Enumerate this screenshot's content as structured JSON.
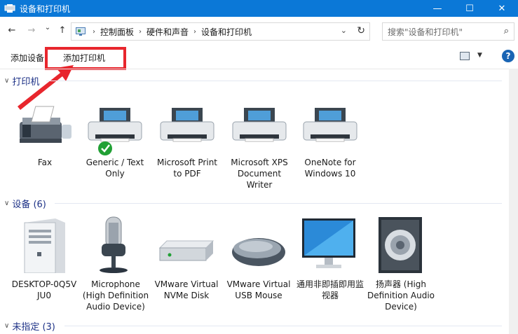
{
  "window": {
    "title": "设备和打印机",
    "min_label": "—",
    "max_label": "☐",
    "close_label": "✕"
  },
  "nav": {
    "back": "←",
    "forward": "→",
    "recent": "⌄",
    "up": "↑"
  },
  "address": {
    "crumbs": [
      "控制面板",
      "硬件和声音",
      "设备和打印机"
    ],
    "dropdown": "⌄",
    "refresh": "↻"
  },
  "search": {
    "placeholder": "搜索\"设备和打印机\"",
    "icon": "⌕"
  },
  "toolbar": {
    "add_device": "添加设备",
    "add_printer": "添加打印机",
    "help": "?"
  },
  "groups": {
    "printers": {
      "label": "打印机"
    },
    "devices": {
      "label": "设备 (6)"
    },
    "unspecified": {
      "label": "未指定 (3)"
    }
  },
  "printers": [
    {
      "name": "Fax"
    },
    {
      "name": "Generic / Text Only",
      "default": true
    },
    {
      "name": "Microsoft Print to PDF"
    },
    {
      "name": "Microsoft XPS Document Writer"
    },
    {
      "name": "OneNote for Windows 10"
    }
  ],
  "devices": [
    {
      "name": "DESKTOP-0Q5V JU0"
    },
    {
      "name": "Microphone (High Definition Audio Device)"
    },
    {
      "name": "VMware Virtual NVMe Disk"
    },
    {
      "name": "VMware Virtual USB Mouse"
    },
    {
      "name": "通用非即插即用监视器"
    },
    {
      "name": "扬声器 (High Definition Audio Device)"
    }
  ],
  "colors": {
    "titlebar": "#0b78d7",
    "highlight": "#e8262d",
    "group_text": "#1e3287"
  }
}
